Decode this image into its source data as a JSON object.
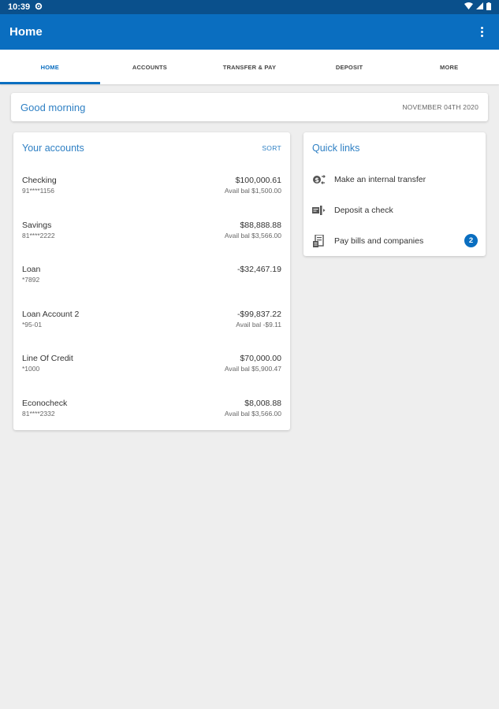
{
  "status_bar": {
    "time": "10:39"
  },
  "app_bar": {
    "title": "Home"
  },
  "tabs": [
    {
      "label": "HOME",
      "active": true
    },
    {
      "label": "ACCOUNTS",
      "active": false
    },
    {
      "label": "TRANSFER & PAY",
      "active": false
    },
    {
      "label": "DEPOSIT",
      "active": false
    },
    {
      "label": "MORE",
      "active": false
    }
  ],
  "greeting": {
    "text": "Good morning",
    "date": "NOVEMBER 04TH 2020"
  },
  "accounts": {
    "title": "Your accounts",
    "sort_label": "SORT",
    "items": [
      {
        "name": "Checking",
        "number": "91****1156",
        "balance": "$100,000.61",
        "available": "Avail bal $1,500.00"
      },
      {
        "name": "Savings",
        "number": "81****2222",
        "balance": "$88,888.88",
        "available": "Avail bal $3,566.00"
      },
      {
        "name": "Loan",
        "number": "*7892",
        "balance": "-$32,467.19",
        "available": ""
      },
      {
        "name": "Loan Account 2",
        "number": "*95-01",
        "balance": "-$99,837.22",
        "available": "Avail bal -$9.11"
      },
      {
        "name": "Line Of Credit",
        "number": "*1000",
        "balance": "$70,000.00",
        "available": "Avail bal $5,900.47"
      },
      {
        "name": "Econocheck",
        "number": "81****2332",
        "balance": "$8,008.88",
        "available": "Avail bal $3,566.00"
      }
    ]
  },
  "quick_links": {
    "title": "Quick links",
    "items": [
      {
        "label": "Make an internal transfer",
        "icon": "transfer-icon"
      },
      {
        "label": "Deposit a check",
        "icon": "check-deposit-icon"
      },
      {
        "label": "Pay bills and companies",
        "icon": "bill-pay-icon",
        "badge": "2"
      }
    ]
  },
  "colors": {
    "primary": "#0a6ec0",
    "status_bar": "#0a508c",
    "accent_text": "#2f80c4",
    "background": "#eeeeee"
  }
}
